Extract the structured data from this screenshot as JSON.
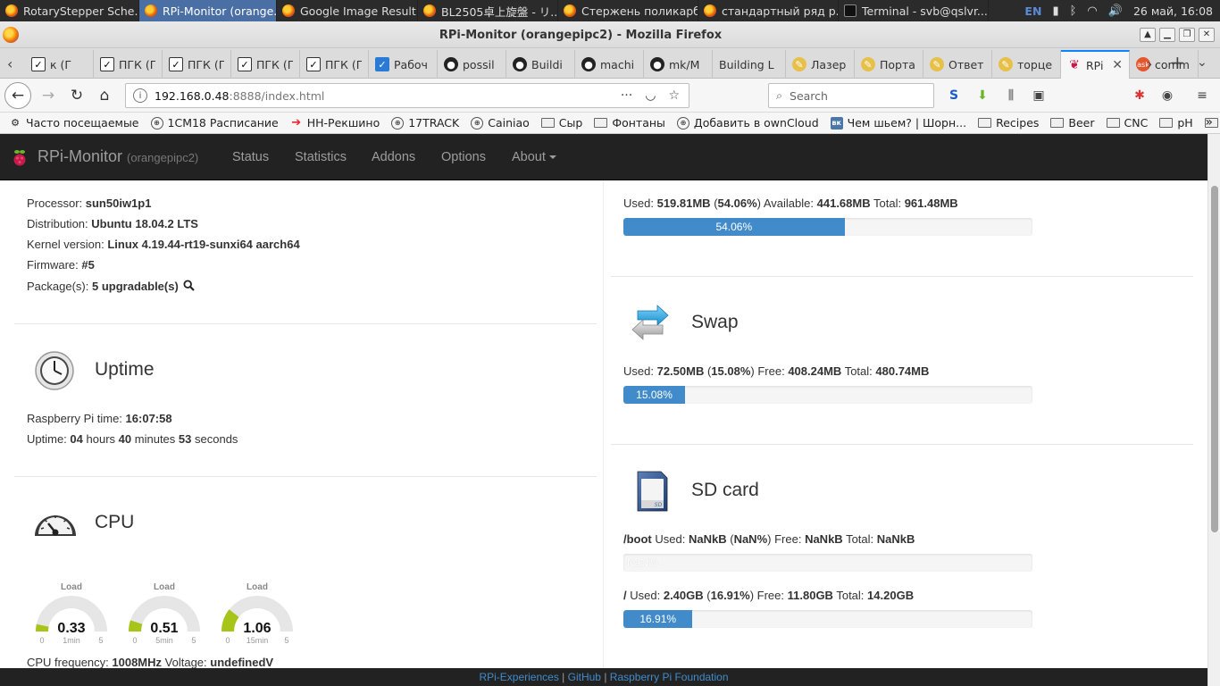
{
  "taskbar": {
    "tasks": [
      {
        "label": "RotaryStepper Sche...",
        "icon": "firefox-icon"
      },
      {
        "label": "RPi-Monitor (orange...",
        "icon": "firefox-icon",
        "active": true
      },
      {
        "label": "Google Image Result...",
        "icon": "firefox-icon"
      },
      {
        "label": "BL2505卓上旋盤 - リ...",
        "icon": "firefox-icon"
      },
      {
        "label": "Стержень поликарб...",
        "icon": "firefox-icon"
      },
      {
        "label": "стандартный ряд р...",
        "icon": "firefox-icon"
      },
      {
        "label": "Terminal - svb@qslvr...",
        "icon": "terminal-icon"
      }
    ],
    "lang": "EN",
    "clock": "26 май, 16:08"
  },
  "window": {
    "title": "RPi-Monitor (orangepipc2) - Mozilla Firefox"
  },
  "tabs": [
    {
      "label": "к (Г",
      "icon": "check"
    },
    {
      "label": "ПГК (Г",
      "icon": "check"
    },
    {
      "label": "ПГК (Г",
      "icon": "check"
    },
    {
      "label": "ПГК (Г",
      "icon": "check"
    },
    {
      "label": "ПГК (Г",
      "icon": "check"
    },
    {
      "label": "Рабоч",
      "icon": "checkblue"
    },
    {
      "label": "possil",
      "icon": "gh"
    },
    {
      "label": "Buildi",
      "icon": "gh"
    },
    {
      "label": "machi",
      "icon": "gh"
    },
    {
      "label": "mk/M",
      "icon": "gh"
    },
    {
      "label": "Building L",
      "icon": "none"
    },
    {
      "label": "Лазер",
      "icon": "pen"
    },
    {
      "label": "Порта",
      "icon": "pen"
    },
    {
      "label": "Ответ",
      "icon": "pen"
    },
    {
      "label": "торце",
      "icon": "pen"
    },
    {
      "label": "RPi",
      "icon": "rpi",
      "selected": true
    },
    {
      "label": "comm",
      "icon": "ask"
    }
  ],
  "nav": {
    "url_host": "192.168.0.48",
    "url_path": ":8888/index.html",
    "search_placeholder": "Search"
  },
  "bookmarks": [
    {
      "label": "Часто посещаемые",
      "icon": "gear"
    },
    {
      "label": "1CM18 Расписание",
      "icon": "globe"
    },
    {
      "label": "НН-Рекшино",
      "icon": "arrowred"
    },
    {
      "label": "17TRACK",
      "icon": "globe"
    },
    {
      "label": "Cainiao",
      "icon": "globe"
    },
    {
      "label": "Сыр",
      "icon": "folder"
    },
    {
      "label": "Фонтаны",
      "icon": "folder"
    },
    {
      "label": "Добавить в ownCloud",
      "icon": "globe"
    },
    {
      "label": "Чем шьем? | Шорн...",
      "icon": "vk"
    },
    {
      "label": "Recipes",
      "icon": "folder"
    },
    {
      "label": "Beer",
      "icon": "folder"
    },
    {
      "label": "CNC",
      "icon": "folder"
    },
    {
      "label": "pH",
      "icon": "folder"
    },
    {
      "label": "LED",
      "icon": "folder"
    }
  ],
  "rpi_nav": {
    "brand": "RPi-Monitor",
    "host": "(orangepipc2)",
    "items": [
      "Status",
      "Statistics",
      "Addons",
      "Options",
      "About"
    ]
  },
  "version": {
    "processor_label": "Processor:",
    "processor": "sun50iw1p1",
    "distribution_label": "Distribution:",
    "distribution": "Ubuntu 18.04.2 LTS",
    "kernel_label": "Kernel version:",
    "kernel": "Linux 4.19.44-rt19-sunxi64 aarch64",
    "firmware_label": "Firmware:",
    "firmware": "#5",
    "packages_label": "Package(s):",
    "packages": "5 upgradable(s)"
  },
  "uptime": {
    "title": "Uptime",
    "time_label": "Raspberry Pi time:",
    "time": "16:07:58",
    "uptime_label": "Uptime:",
    "hours": "04",
    "hours_unit": "hours",
    "minutes": "40",
    "minutes_unit": "minutes",
    "seconds": "53",
    "seconds_unit": "seconds"
  },
  "cpu": {
    "title": "CPU",
    "gauges": [
      {
        "label": "Load",
        "value": 0.33,
        "value_text": "0.33",
        "period": "1min",
        "min": "0",
        "max": "5"
      },
      {
        "label": "Load",
        "value": 0.51,
        "value_text": "0.51",
        "period": "5min",
        "min": "0",
        "max": "5"
      },
      {
        "label": "Load",
        "value": 1.06,
        "value_text": "1.06",
        "period": "15min",
        "min": "0",
        "max": "5"
      }
    ],
    "frequency_label": "CPU frequency:",
    "frequency": "1008MHz",
    "voltage_label": "Voltage:",
    "voltage": "undefinedV"
  },
  "memory": {
    "used_label": "Used:",
    "used": "519.81MB",
    "used_pct": "54.06%",
    "available_label": "Available:",
    "available": "441.68MB",
    "total_label": "Total:",
    "total": "961.48MB",
    "bar_text": "54.06%",
    "bar_value": 54.06
  },
  "swap": {
    "title": "Swap",
    "used_label": "Used:",
    "used": "72.50MB",
    "used_pct": "15.08%",
    "free_label": "Free:",
    "free": "408.24MB",
    "total_label": "Total:",
    "total": "480.74MB",
    "bar_text": "15.08%",
    "bar_value": 15.08
  },
  "sdcard": {
    "title": "SD card",
    "boot_mount": "/boot",
    "boot_used_label": "Used:",
    "boot_used": "NaNkB",
    "boot_pct": "NaN%",
    "boot_free_label": "Free:",
    "boot_free": "NaNkB",
    "boot_total_label": "Total:",
    "boot_total": "NaNkB",
    "boot_bar_text": "NaN%",
    "root_mount": "/",
    "root_used_label": "Used:",
    "root_used": "2.40GB",
    "root_pct": "16.91%",
    "root_free_label": "Free:",
    "root_free": "11.80GB",
    "root_total_label": "Total:",
    "root_total": "14.20GB",
    "root_bar_text": "16.91%",
    "root_bar_value": 16.91
  },
  "footer": {
    "link1": "RPi-Experiences",
    "sep1": " | ",
    "link2": "GitHub",
    "sep2": " | ",
    "link3": "Raspberry Pi Foundation"
  },
  "colors": {
    "accent": "#428bca",
    "gauge_fill": "#a7c519",
    "navbar": "#222222"
  }
}
